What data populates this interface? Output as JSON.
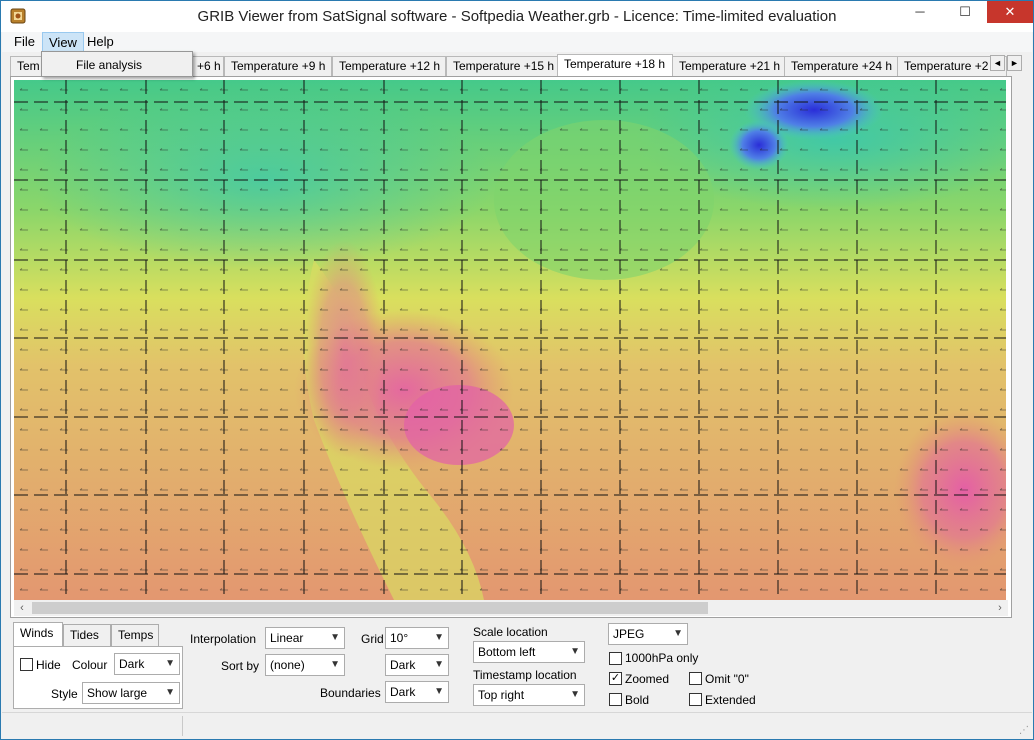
{
  "window": {
    "title": "GRIB Viewer from SatSignal software - Softpedia Weather.grb - Licence: Time-limited evaluation",
    "minimize": "─",
    "maximize": "☐",
    "close": "✕"
  },
  "menu": {
    "file": "File",
    "view": "View",
    "help": "Help",
    "dropdown_item": "File analysis"
  },
  "tabs": [
    {
      "label": "Tem"
    },
    {
      "label": "+6 h"
    },
    {
      "label": "Temperature +9 h"
    },
    {
      "label": "Temperature +12 h"
    },
    {
      "label": "Temperature +15 h"
    },
    {
      "label": "Temperature +18 h"
    },
    {
      "label": "Temperature +21 h"
    },
    {
      "label": "Temperature +24 h"
    },
    {
      "label": "Temperature +2"
    }
  ],
  "tab_scroll": {
    "left": "◄",
    "right": "►"
  },
  "map": {
    "scroll_left": "‹",
    "scroll_right": "›"
  },
  "panel": {
    "tabs": [
      "Winds",
      "Tides",
      "Temps"
    ],
    "hide_label": "Hide",
    "colour_label": "Colour",
    "colour_value": "Dark",
    "style_label": "Style",
    "style_value": "Show large"
  },
  "controls": {
    "interpolation_label": "Interpolation",
    "interpolation_value": "Linear",
    "sortby_label": "Sort by",
    "sortby_value": "(none)",
    "grid_label": "Grid",
    "grid_value": "10°",
    "grid_colour_value": "Dark",
    "boundaries_label": "Boundaries",
    "boundaries_value": "Dark",
    "scale_location_label": "Scale location",
    "scale_location_value": "Bottom left",
    "timestamp_location_label": "Timestamp location",
    "timestamp_location_value": "Top right",
    "format_value": "JPEG",
    "hpa_label": "1000hPa only",
    "zoomed_label": "Zoomed",
    "zoomed_check": "✓",
    "omit_label": "Omit \"0\"",
    "bold_label": "Bold",
    "extended_label": "Extended"
  },
  "status": {
    "grip": "⋰"
  }
}
